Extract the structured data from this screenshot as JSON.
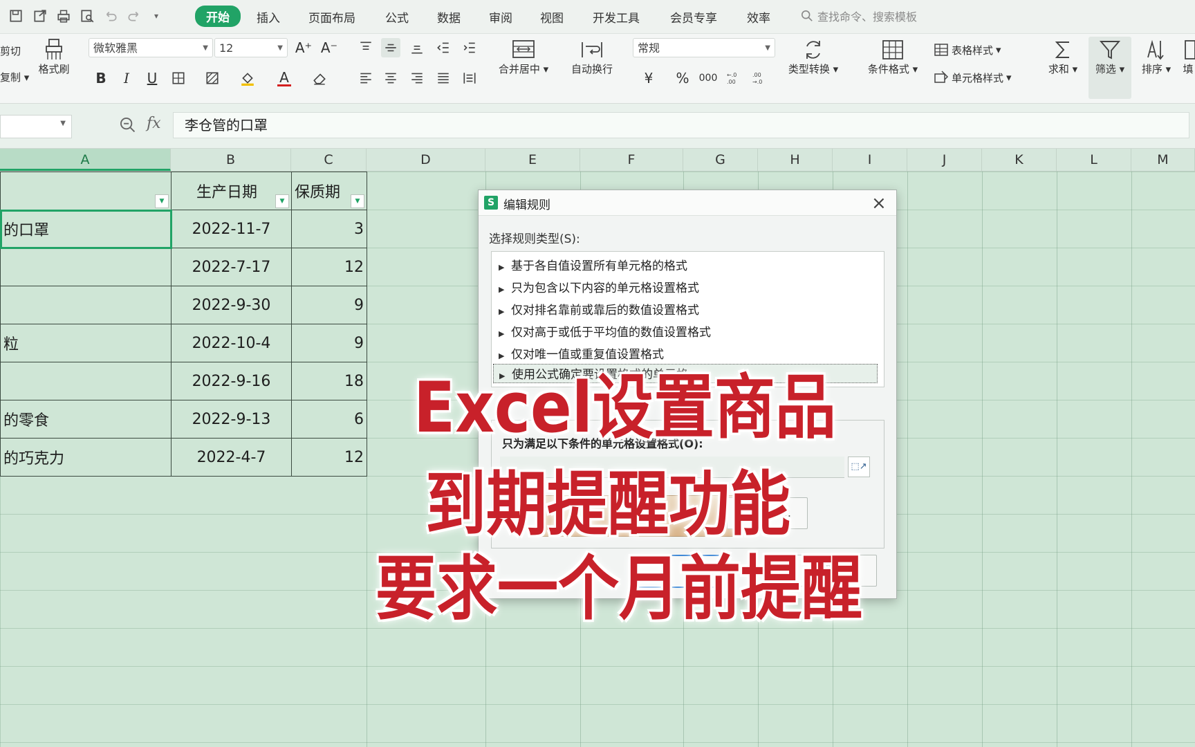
{
  "menubar": {
    "tabs": [
      "开始",
      "插入",
      "页面布局",
      "公式",
      "数据",
      "审阅",
      "视图",
      "开发工具",
      "会员专享",
      "效率"
    ],
    "active_tab": "开始",
    "search_placeholder": "查找命令、搜索模板"
  },
  "ribbon": {
    "cut_label": "剪切",
    "copy_label": "复制",
    "format_painter": "格式刷",
    "font_name": "微软雅黑",
    "font_size": "12",
    "font_grow": "A⁺",
    "font_shrink": "A⁻",
    "bold": "B",
    "italic": "I",
    "underline": "U",
    "font_color_glyph": "A",
    "merge_center": "合并居中",
    "wrap_text": "自动换行",
    "number_format": "常规",
    "currency": "¥",
    "percent": "%",
    "thousands": "000",
    "type_convert": "类型转换",
    "conditional_format": "条件格式",
    "table_style": "表格样式",
    "cell_style": "单元格样式",
    "sum": "求和",
    "filter": "筛选",
    "sort": "排序",
    "fill": "填"
  },
  "formula_bar": {
    "fx": "fx",
    "content": "李仓管的口罩"
  },
  "columns": [
    "A",
    "B",
    "C",
    "D",
    "E",
    "F",
    "G",
    "H",
    "I",
    "J",
    "K",
    "L",
    "M"
  ],
  "table": {
    "headers": [
      "",
      "生产日期",
      "保质期"
    ],
    "rows": [
      {
        "name": "的口罩",
        "date": "2022-11-7",
        "shelf": "3"
      },
      {
        "name": "",
        "date": "2022-7-17",
        "shelf": "12"
      },
      {
        "name": "",
        "date": "2022-9-30",
        "shelf": "9"
      },
      {
        "name": "粒",
        "date": "2022-10-4",
        "shelf": "9"
      },
      {
        "name": "",
        "date": "2022-9-16",
        "shelf": "18"
      },
      {
        "name": "的零食",
        "date": "2022-9-13",
        "shelf": "6"
      },
      {
        "name": "的巧克力",
        "date": "2022-4-7",
        "shelf": "12"
      }
    ]
  },
  "dialog": {
    "title": "编辑规则",
    "select_type_label": "选择规则类型(S):",
    "rule_types": [
      "基于各自值设置所有单元格的格式",
      "只为包含以下内容的单元格设置格式",
      "仅对排名靠前或靠后的数值设置格式",
      "仅对高于或低于平均值的数值设置格式",
      "仅对唯一值或重复值设置格式",
      "使用公式确定要设置格式的单元格"
    ],
    "condition_label": "只为满足以下条件的单元格设置格式(O):",
    "format_button": "格式(F)...",
    "cancel_button": "取消"
  },
  "caption": {
    "line1": "Excel设置商品",
    "line2": "到期提醒功能",
    "line3": "要求一个月前提醒",
    "color": "#c8212a"
  }
}
